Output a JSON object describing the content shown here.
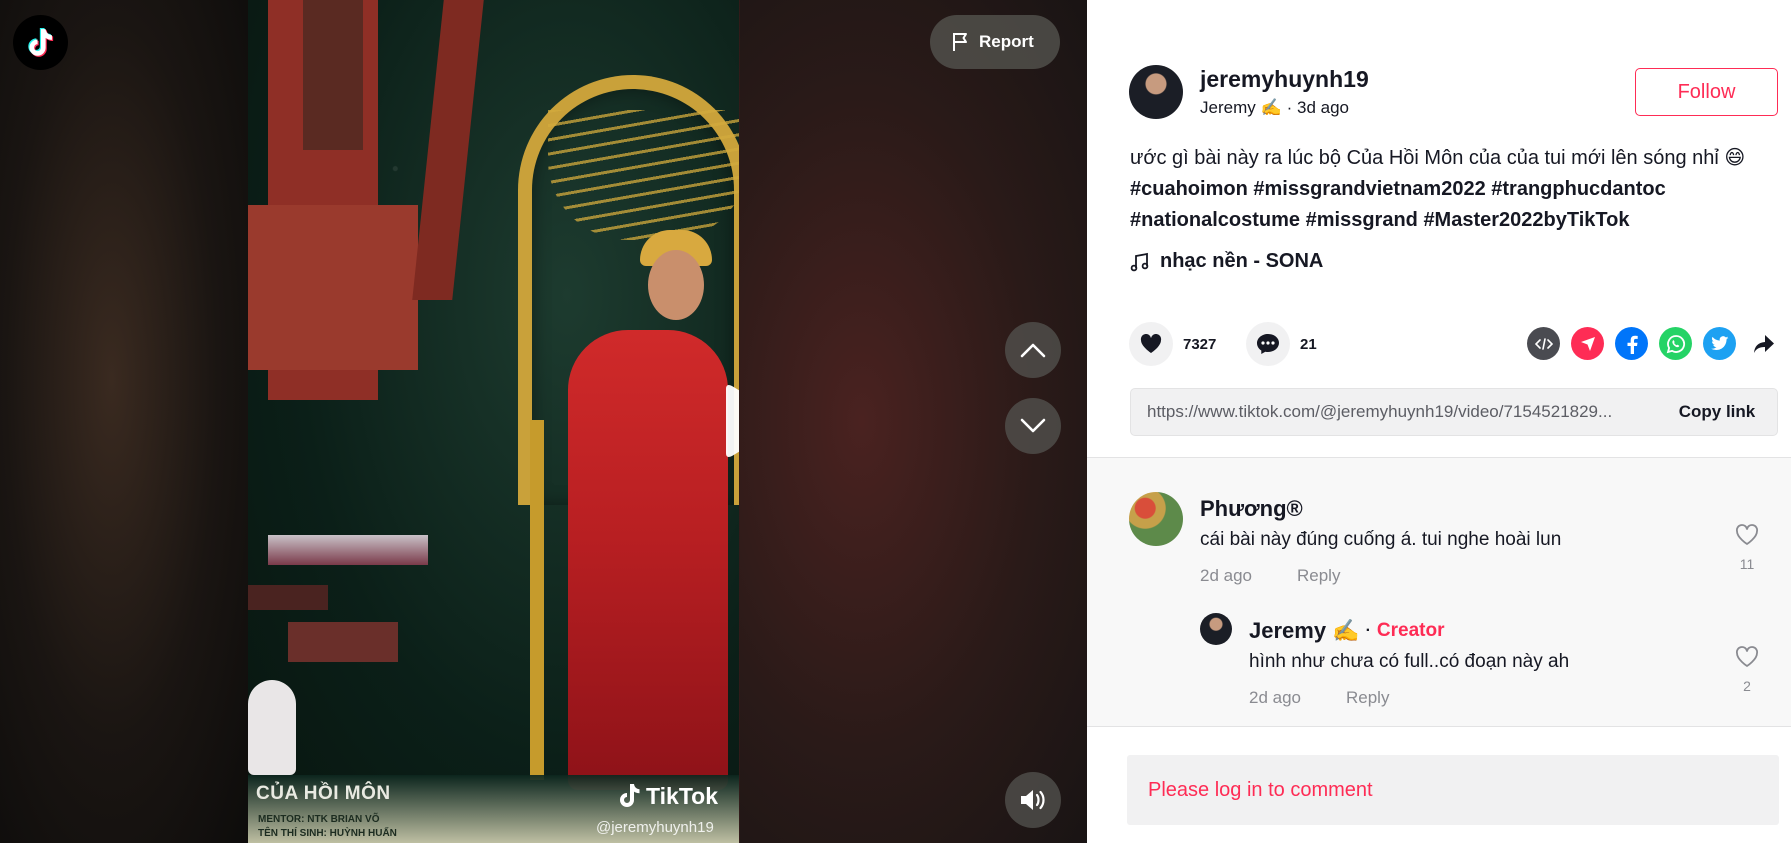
{
  "video": {
    "report_label": "Report",
    "caption_title": "CỦA HỒI MÔN",
    "caption_mentor": "MENTOR: NTK BRIAN VÕ",
    "caption_contestant": "TÊN THÍ SINH: HUỲNH HUẤN",
    "watermark_brand": "TikTok",
    "watermark_handle": "@jeremyhuynh19"
  },
  "author": {
    "username": "jeremyhuynh19",
    "nickname": "Jeremy ✍️",
    "time": "· 3d ago",
    "follow_label": "Follow"
  },
  "post": {
    "text": "ước gì bài này ra lúc bộ Của Hồi Môn của của tui mới lên sóng nhỉ",
    "emoji": "😄",
    "hashtags": [
      "#cuahoimon",
      "#missgrandvietnam2022",
      "#trangphucdantoc",
      "#nationalcostume",
      "#missgrand",
      "#Master2022byTikTok"
    ],
    "music": "nhạc nền - SONA"
  },
  "stats": {
    "likes": "7327",
    "comments": "21"
  },
  "share": {
    "link": "https://www.tiktok.com/@jeremyhuynh19/video/7154521829...",
    "copy_label": "Copy link",
    "icons": [
      "embed-icon",
      "send-icon",
      "facebook-icon",
      "whatsapp-icon",
      "twitter-icon",
      "share-arrow-icon"
    ]
  },
  "comments": [
    {
      "name": "Phương®",
      "text": "cái bài này đúng cuống á. tui nghe hoài lun",
      "time": "2d ago",
      "reply_label": "Reply",
      "likes": "11"
    },
    {
      "name": "Jeremy ✍️",
      "separator": "·",
      "badge": "Creator",
      "text": "hình như chưa có full..có đoạn này ah",
      "time": "2d ago",
      "reply_label": "Reply",
      "likes": "2"
    }
  ],
  "login_prompt": "Please log in to comment",
  "colors": {
    "accent": "#fe2c55",
    "text": "#161823",
    "muted": "#8a8b91"
  }
}
